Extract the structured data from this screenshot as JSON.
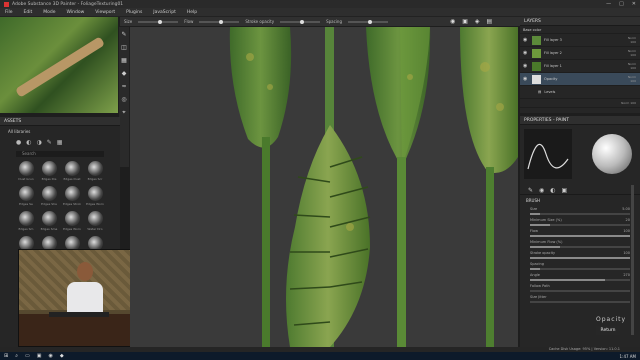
{
  "app": {
    "title": "Adobe Substance 3D Painter - FoliageTexturing01",
    "window_controls": [
      "—",
      "□",
      "✕"
    ]
  },
  "menu": [
    "File",
    "Edit",
    "Mode",
    "Window",
    "Viewport",
    "Plugins",
    "JavaScript",
    "Help"
  ],
  "toolbar": {
    "size_label": "Size",
    "flow_label": "Flow",
    "stroke_opacity_label": "Stroke opacity",
    "spacing_label": "Spacing",
    "material_label": "Material"
  },
  "assets": {
    "header": "ASSETS",
    "library": "All libraries",
    "search_placeholder": "Search",
    "items": [
      "Dust Grun",
      "Edges Dis",
      "Edges Dust",
      "Edges Scr",
      "Edges Se",
      "Edges Sha",
      "Edges Strok",
      "Edges Worn",
      "Edges Sm",
      "Edges Sma",
      "Edges Worn",
      "Water Dro",
      "Edges Gr",
      "Fabric Dia",
      "Fabric Roll",
      "Fabric Zoo"
    ]
  },
  "layers": {
    "header": "LAYERS",
    "blend": "Base color",
    "rows": [
      {
        "name": "Fill layer 3",
        "mode": "Norm",
        "value": "100"
      },
      {
        "name": "Fill layer 2",
        "mode": "Norm",
        "value": "100"
      },
      {
        "name": "Fill layer 1",
        "mode": "Norm",
        "value": "100"
      },
      {
        "name": "Opacity",
        "mode": "Norm",
        "value": "100"
      },
      {
        "name": "Levels",
        "mode": "",
        "value": ""
      },
      {
        "name": "",
        "mode": "Norm",
        "value": "100"
      }
    ]
  },
  "properties": {
    "header": "PROPERTIES - PAINT",
    "brush_section": "BRUSH",
    "props": [
      {
        "label": "Size",
        "value": "5.00",
        "fill": 0.1
      },
      {
        "label": "Minimum Size (%)",
        "value": "20",
        "fill": 0.2
      },
      {
        "label": "Flow",
        "value": "100",
        "fill": 1.0
      },
      {
        "label": "Minimum Flow (%)",
        "value": "",
        "fill": 0.3
      },
      {
        "label": "Stroke opacity",
        "value": "100",
        "fill": 1.0
      },
      {
        "label": "Spacing",
        "value": "",
        "fill": 0.1
      },
      {
        "label": "Angle",
        "value": "270",
        "fill": 0.75
      },
      {
        "label": "Follow Path",
        "value": "",
        "fill": 0
      },
      {
        "label": "Size Jitter",
        "value": "",
        "fill": 0
      }
    ]
  },
  "status": "Cache Disk Usage: 95% | Version: 11.0.1",
  "watermark": "Opacity",
  "return_label": "Return",
  "taskbar_time": "1:47 AM"
}
